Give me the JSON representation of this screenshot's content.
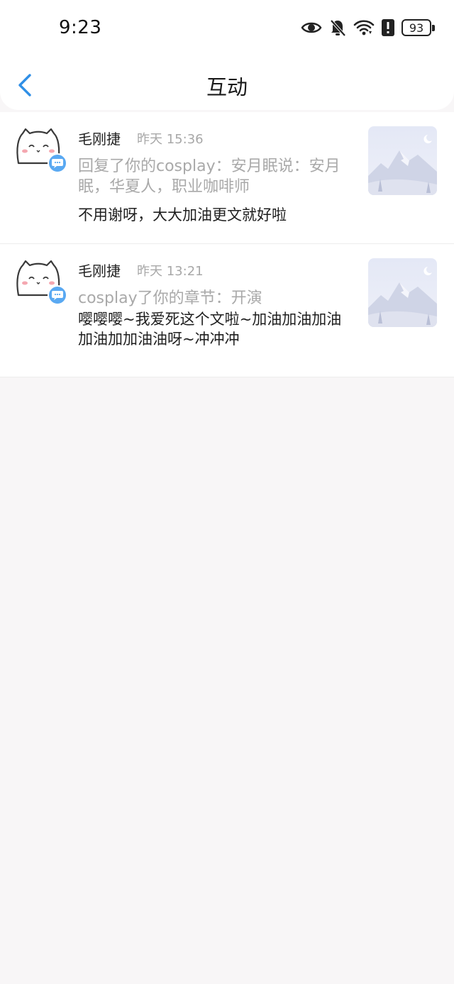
{
  "status_bar": {
    "time": "9:23",
    "battery": "93",
    "icons": [
      "eye-icon",
      "bell-off-icon",
      "wifi-icon",
      "alert-icon",
      "battery-icon"
    ]
  },
  "nav": {
    "back_icon": "chevron-left-icon",
    "title": "互动"
  },
  "items": [
    {
      "name": "毛刚捷",
      "time": "昨天 15:36",
      "ref": "回复了你的cosplay：安月眠说：安月眠，华夏人，职业咖啡师",
      "message": "不用谢呀，大大加油更文就好啦"
    },
    {
      "name": "毛刚捷",
      "time": "昨天 13:21",
      "ref": "cosplay了你的章节：开演",
      "message": "嘤嘤嘤~我爱死这个文啦~加油加油加油加油加加油油呀~冲冲冲"
    }
  ],
  "colors": {
    "accent": "#2f8fe6",
    "badge": "#5aa9f2",
    "background": "#f8f6f7",
    "secondary_text": "#a9a9a9"
  }
}
